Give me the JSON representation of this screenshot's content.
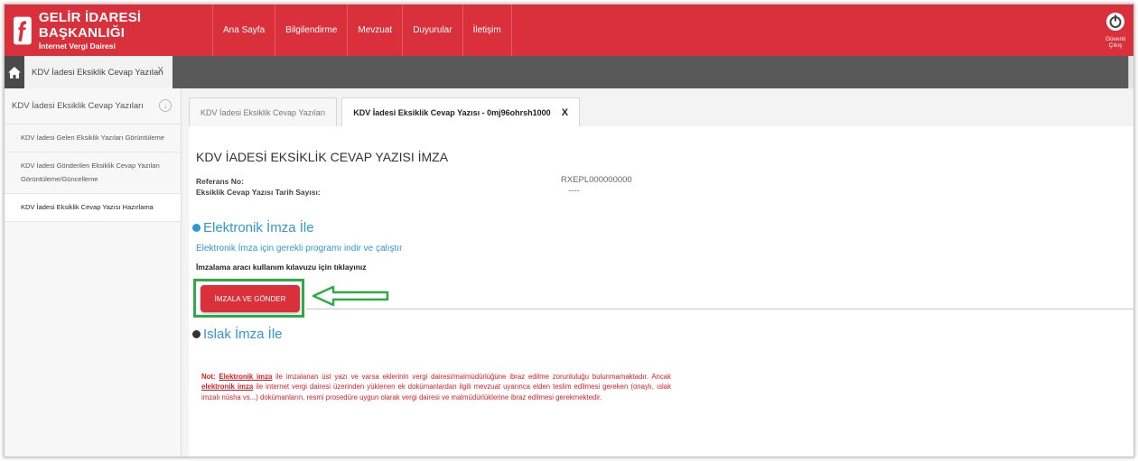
{
  "header": {
    "title": "GELİR İDARESİ BAŞKANLIĞI",
    "subtitle": "İnternet Vergi Dairesi",
    "nav": [
      "Ana Sayfa",
      "Bilgilendirme",
      "Mevzuat",
      "Duyurular",
      "İletişim"
    ],
    "logout_label": "Güvenli Çıkış"
  },
  "tabbar": {
    "tab_label": "KDV İadesi Eksiklik Cevap Yazıları",
    "close": "X"
  },
  "sidebar": {
    "title": "KDV İadesi Eksiklik Cevap Yazıları",
    "items": [
      {
        "label": "KDV İadesi Gelen Eksiklik Yazıları Görüntüleme"
      },
      {
        "label": "KDV İadesi Gönderilen Eksiklik Cevap Yazıları Görüntüleme/Güncelleme"
      },
      {
        "label": "KDV İadesi Eksiklik Cevap Yazısı Hazırlama"
      }
    ]
  },
  "content": {
    "tabs": [
      {
        "label": "KDV İadesi Eksiklik Cevap Yazıları"
      },
      {
        "label": "KDV İadesi Eksiklik Cevap Yazısı - 0mj96ohrsh1000",
        "close": "X"
      }
    ],
    "page_title": "KDV İADESİ EKSİKLİK CEVAP YAZISI İMZA",
    "ref_label": "Referans No:",
    "ref_value": "RXEPL000000000",
    "date_label": "Eksiklik Cevap Yazısı Tarih Sayısı:",
    "date_value": "----",
    "electronic_title": "Elektronik İmza İle",
    "electronic_link": "Elektronik İmza için gerekli programı indir ve çalıştır",
    "guide_text": "İmzalama aracı kullanım kılavuzu için tıklayınız",
    "sign_button": "İMZALA VE GÖNDER",
    "wet_title": "Islak İmza İle",
    "note": {
      "prefix": "Not:",
      "kw1": "Elektronik imza",
      "part1": " ile imzalanan üst yazı ve varsa eklerinin vergi dairesi/malmüdürlüğüne ibraz edilme zorunluluğu bulunmamaktadır. Ancak ",
      "kw2": "elektronik imza",
      "part2": " ile internet vergi dairesi üzerinden yüklenen ek dokümanlardan ilgili mevzuat uyarınca elden teslim edilmesi gereken (onaylı, ıslak imzalı nüsha vs...) dokümanların, resmi prosedüre uygun olarak vergi dairesi ve malmüdürlüklerine ibraz edilmesi gerekmektedir."
    }
  },
  "colors": {
    "brand_red": "#d9303c",
    "highlight_green": "#2dab44",
    "link_blue": "#2f98d3",
    "note_red": "#e01c24"
  }
}
